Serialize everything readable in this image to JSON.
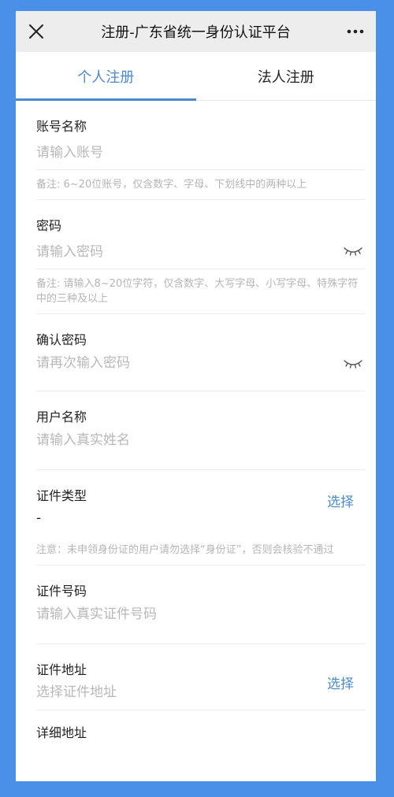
{
  "header": {
    "title": "注册-广东省统一身份认证平台"
  },
  "tabs": [
    {
      "label": "个人注册",
      "active": true
    },
    {
      "label": "法人注册",
      "active": false
    }
  ],
  "form": {
    "account": {
      "label": "账号名称",
      "placeholder": "请输入账号",
      "note": "备注: 6~20位账号，仅含数字、字母、下划线中的两种以上"
    },
    "password": {
      "label": "密码",
      "placeholder": "请输入密码",
      "note": "备注: 请输入8~20位字符，仅含数字、大写字母、小写字母、特殊字符中的三种及以上"
    },
    "confirm_password": {
      "label": "确认密码",
      "placeholder": "请再次输入密码"
    },
    "username": {
      "label": "用户名称",
      "placeholder": "请输入真实姓名"
    },
    "id_type": {
      "label": "证件类型",
      "value": "-",
      "select_label": "选择",
      "note": "注意：未申领身份证的用户请勿选择“身份证”，否则会核验不通过"
    },
    "id_number": {
      "label": "证件号码",
      "placeholder": "请输入真实证件号码"
    },
    "id_address": {
      "label": "证件地址",
      "placeholder": "选择证件地址",
      "select_label": "选择"
    },
    "detail_address": {
      "label": "详细地址"
    }
  },
  "colors": {
    "accent": "#4a8bd0",
    "frame": "#4a8fe8",
    "titlebar": "#ededed"
  },
  "icons": {
    "close": "close-icon",
    "more": "more-dots-icon",
    "eye": "eye-closed-icon"
  }
}
